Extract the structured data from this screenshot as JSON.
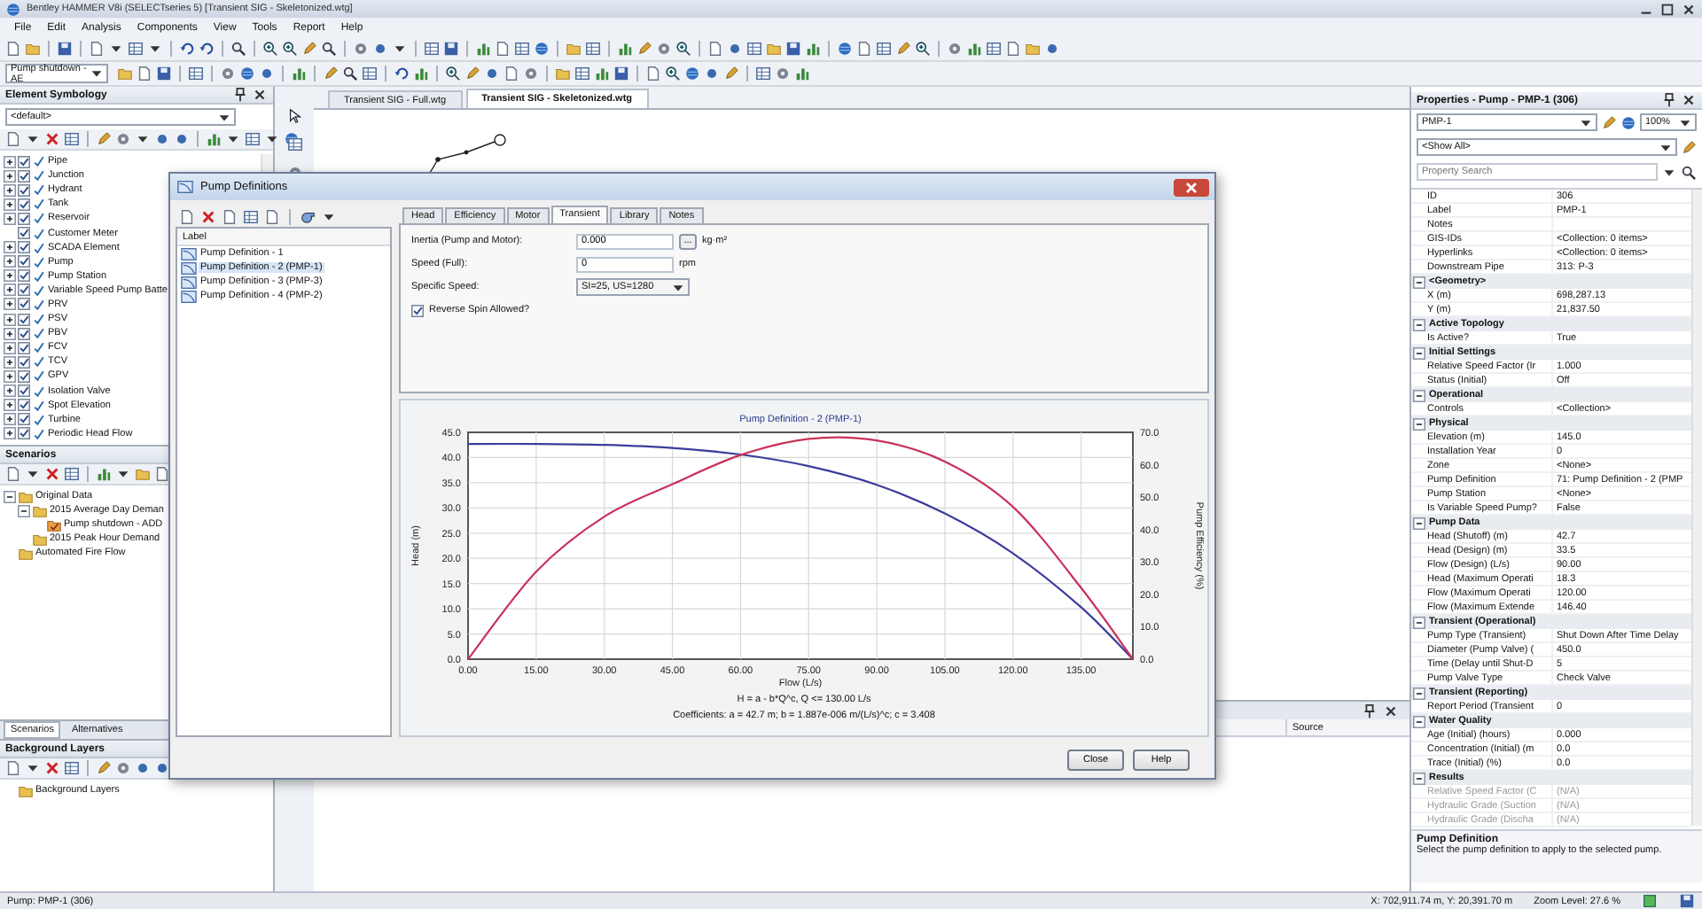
{
  "window": {
    "title": "Bentley HAMMER V8i (SELECTseries 5) [Transient SIG - Skeletonized.wtg]"
  },
  "menu": [
    "File",
    "Edit",
    "Analysis",
    "Components",
    "View",
    "Tools",
    "Report",
    "Help"
  ],
  "toolbar": {
    "scenario": "Pump shutdown - AE"
  },
  "element_symbology": {
    "title": "Element Symbology",
    "filter": "<default>",
    "items": [
      {
        "label": "Pipe",
        "checked": true,
        "expandable": true
      },
      {
        "label": "Junction",
        "checked": true,
        "expandable": true
      },
      {
        "label": "Hydrant",
        "checked": true,
        "expandable": true
      },
      {
        "label": "Tank",
        "checked": true,
        "expandable": true
      },
      {
        "label": "Reservoir",
        "checked": true,
        "expandable": true
      },
      {
        "label": "Customer Meter",
        "checked": true,
        "expandable": false
      },
      {
        "label": "SCADA Element",
        "checked": true,
        "expandable": true
      },
      {
        "label": "Pump",
        "checked": true,
        "expandable": true
      },
      {
        "label": "Pump Station",
        "checked": true,
        "expandable": true
      },
      {
        "label": "Variable Speed Pump Batte",
        "checked": true,
        "expandable": true
      },
      {
        "label": "PRV",
        "checked": true,
        "expandable": true
      },
      {
        "label": "PSV",
        "checked": true,
        "expandable": true
      },
      {
        "label": "PBV",
        "checked": true,
        "expandable": true
      },
      {
        "label": "FCV",
        "checked": true,
        "expandable": true
      },
      {
        "label": "TCV",
        "checked": true,
        "expandable": true
      },
      {
        "label": "GPV",
        "checked": true,
        "expandable": true
      },
      {
        "label": "Isolation Valve",
        "checked": true,
        "expandable": true
      },
      {
        "label": "Spot Elevation",
        "checked": true,
        "expandable": true
      },
      {
        "label": "Turbine",
        "checked": true,
        "expandable": true
      },
      {
        "label": "Periodic Head Flow",
        "checked": true,
        "expandable": true
      }
    ]
  },
  "scenarios": {
    "title": "Scenarios",
    "tree": [
      {
        "label": "Original Data",
        "kind": "folder",
        "expanded": true,
        "children": [
          {
            "label": "2015 Average Day Deman",
            "kind": "folder",
            "expanded": true,
            "children": [
              {
                "label": "Pump shutdown - ADD",
                "kind": "scenario"
              }
            ]
          },
          {
            "label": "2015 Peak Hour Demand",
            "kind": "folder"
          }
        ]
      },
      {
        "label": "Automated Fire Flow",
        "kind": "folder"
      }
    ]
  },
  "left_tabs": [
    {
      "label": "Scenarios",
      "selected": true
    },
    {
      "label": "Alternatives",
      "selected": false
    }
  ],
  "background_layers": {
    "title": "Background Layers",
    "tree": [
      {
        "label": "Background Layers",
        "kind": "folder"
      }
    ]
  },
  "document_tabs": [
    {
      "label": "Transient SIG - Full.wtg",
      "selected": false
    },
    {
      "label": "Transient SIG - Skeletonized.wtg",
      "selected": true
    }
  ],
  "bottom_panel": {
    "columns": [
      "Source"
    ]
  },
  "properties": {
    "title": "Properties - Pump - PMP-1 (306)",
    "element": "PMP-1",
    "zoom": "100%",
    "filter": "<Show All>",
    "search": {
      "placeholder": "Property Search"
    },
    "rows": [
      {
        "kind": "field",
        "label": "ID",
        "value": "306",
        "disabled": false
      },
      {
        "kind": "field",
        "label": "Label",
        "value": "PMP-1",
        "disabled": false
      },
      {
        "kind": "field",
        "label": "Notes",
        "disabled": false
      },
      {
        "kind": "field",
        "label": "GIS-IDs",
        "value": "<Collection: 0 items>",
        "disabled": false
      },
      {
        "kind": "field",
        "label": "Hyperlinks",
        "value": "<Collection: 0 items>",
        "disabled": false
      },
      {
        "kind": "field",
        "label": "Downstream Pipe",
        "value": "313: P-3",
        "disabled": false
      },
      {
        "kind": "group",
        "label": "<Geometry>",
        "expanded": true
      },
      {
        "kind": "field",
        "label": "X (m)",
        "value": "698,287.13",
        "disabled": false
      },
      {
        "kind": "field",
        "label": "Y (m)",
        "value": "21,837.50",
        "disabled": false
      },
      {
        "kind": "group",
        "label": "Active Topology",
        "expanded": true
      },
      {
        "kind": "field",
        "label": "Is Active?",
        "value": "True",
        "disabled": false
      },
      {
        "kind": "group",
        "label": "Initial Settings",
        "expanded": true
      },
      {
        "kind": "field",
        "label": "Relative Speed Factor (Ir",
        "value": "1.000",
        "disabled": false
      },
      {
        "kind": "field",
        "label": "Status (Initial)",
        "value": "Off",
        "disabled": false
      },
      {
        "kind": "group",
        "label": "Operational",
        "expanded": true
      },
      {
        "kind": "field",
        "label": "Controls",
        "value": "<Collection>",
        "disabled": false
      },
      {
        "kind": "group",
        "label": "Physical",
        "expanded": true
      },
      {
        "kind": "field",
        "label": "Elevation (m)",
        "value": "145.0",
        "disabled": false
      },
      {
        "kind": "field",
        "label": "Installation Year",
        "value": "0",
        "disabled": false
      },
      {
        "kind": "field",
        "label": "Zone",
        "value": "<None>",
        "disabled": false
      },
      {
        "kind": "field",
        "label": "Pump Definition",
        "value": "71: Pump Definition - 2 (PMP",
        "disabled": false
      },
      {
        "kind": "field",
        "label": "Pump Station",
        "value": "<None>",
        "disabled": false
      },
      {
        "kind": "field",
        "label": "Is Variable Speed Pump?",
        "value": "False",
        "disabled": false
      },
      {
        "kind": "group",
        "label": "Pump Data",
        "expanded": true
      },
      {
        "kind": "field",
        "label": "Head (Shutoff) (m)",
        "value": "42.7",
        "disabled": false
      },
      {
        "kind": "field",
        "label": "Head (Design) (m)",
        "value": "33.5",
        "disabled": false
      },
      {
        "kind": "field",
        "label": "Flow (Design) (L/s)",
        "value": "90.00",
        "disabled": false
      },
      {
        "kind": "field",
        "label": "Head (Maximum Operati",
        "value": "18.3",
        "disabled": false
      },
      {
        "kind": "field",
        "label": "Flow (Maximum Operati",
        "value": "120.00",
        "disabled": false
      },
      {
        "kind": "field",
        "label": "Flow (Maximum Extende",
        "value": "146.40",
        "disabled": false
      },
      {
        "kind": "group",
        "label": "Transient (Operational)",
        "expanded": true
      },
      {
        "kind": "field",
        "label": "Pump Type (Transient)",
        "value": "Shut Down After Time Delay",
        "disabled": false
      },
      {
        "kind": "field",
        "label": "Diameter (Pump Valve) (",
        "value": "450.0",
        "disabled": false
      },
      {
        "kind": "field",
        "label": "Time (Delay until Shut-D",
        "value": "5",
        "disabled": false
      },
      {
        "kind": "field",
        "label": "Pump Valve Type",
        "value": "Check Valve",
        "disabled": false
      },
      {
        "kind": "group",
        "label": "Transient (Reporting)",
        "expanded": true
      },
      {
        "kind": "field",
        "label": "Report Period (Transient",
        "value": "0",
        "disabled": false
      },
      {
        "kind": "group",
        "label": "Water Quality",
        "expanded": true
      },
      {
        "kind": "field",
        "label": "Age (Initial) (hours)",
        "value": "0.000",
        "disabled": false
      },
      {
        "kind": "field",
        "label": "Concentration (Initial) (m",
        "value": "0.0",
        "disabled": false
      },
      {
        "kind": "field",
        "label": "Trace (Initial) (%)",
        "value": "0.0",
        "disabled": false
      },
      {
        "kind": "group",
        "label": "Results",
        "expanded": true
      },
      {
        "kind": "field",
        "label": "Relative Speed Factor (C",
        "value": "(N/A)",
        "disabled": true
      },
      {
        "kind": "field",
        "label": "Hydraulic Grade (Suction",
        "value": "(N/A)",
        "disabled": true
      },
      {
        "kind": "field",
        "label": "Hydraulic Grade (Discha",
        "value": "(N/A)",
        "disabled": true
      }
    ],
    "description": {
      "title": "Pump Definition",
      "text": "Select the pump definition to apply to the selected pump."
    }
  },
  "dialog": {
    "title": "Pump Definitions",
    "list_header": "Label",
    "definitions": [
      {
        "label": "Pump Definition - 1",
        "selected": false
      },
      {
        "label": "Pump Definition - 2 (PMP-1)",
        "selected": true
      },
      {
        "label": "Pump Definition - 3 (PMP-3)",
        "selected": false
      },
      {
        "label": "Pump Definition - 4 (PMP-2)",
        "selected": false
      }
    ],
    "tabs": [
      {
        "label": "Head",
        "selected": false
      },
      {
        "label": "Efficiency",
        "selected": false
      },
      {
        "label": "Motor",
        "selected": false
      },
      {
        "label": "Transient",
        "selected": true
      },
      {
        "label": "Library",
        "selected": false
      },
      {
        "label": "Notes",
        "selected": false
      }
    ],
    "fields": [
      {
        "kind": "number-button",
        "label": "Inertia (Pump and Motor):",
        "value": "0.000",
        "button": "...",
        "unit": "kg·m²"
      },
      {
        "kind": "number",
        "label": "Speed (Full):",
        "value": "0",
        "unit": "rpm"
      },
      {
        "kind": "select",
        "label": "Specific Speed:",
        "value": "SI=25, US=1280"
      },
      {
        "kind": "checkbox",
        "label": "Reverse Spin Allowed?",
        "checked": true
      }
    ],
    "chart_data": {
      "type": "line",
      "title": "Pump Definition - 2 (PMP-1)",
      "xlabel": "Flow (L/s)",
      "ylabel": "Head (m)",
      "y2label": "Pump Efficiency (%)",
      "x": [
        0,
        15,
        30,
        45,
        60,
        75,
        90,
        105,
        120,
        135,
        146.4
      ],
      "series": [
        {
          "color": "#3c3c9c",
          "values": [
            42.7,
            42.7,
            42.5,
            41.9,
            40.6,
            38.3,
            34.6,
            28.9,
            21.0,
            10.3,
            0
          ]
        },
        {
          "color": "#c8325a",
          "axis": "y2",
          "values": [
            0,
            27,
            44,
            54,
            63,
            68,
            67.5,
            61,
            47,
            22,
            0
          ]
        }
      ],
      "grid": true,
      "xlim": [
        0,
        146.4
      ],
      "ylim": [
        0,
        45
      ],
      "y2lim": [
        0,
        70
      ],
      "xticks": [
        {
          "value": 0,
          "label": "0.00"
        },
        {
          "value": 15,
          "label": "15.00"
        },
        {
          "value": 30,
          "label": "30.00"
        },
        {
          "value": 45,
          "label": "45.00"
        },
        {
          "value": 60,
          "label": "60.00"
        },
        {
          "value": 75,
          "label": "75.00"
        },
        {
          "value": 90,
          "label": "90.00"
        },
        {
          "value": 105,
          "label": "105.00"
        },
        {
          "value": 120,
          "label": "120.00"
        },
        {
          "value": 135,
          "label": "135.00"
        }
      ],
      "yticks": [
        {
          "value": 0,
          "label": "0.0"
        },
        {
          "value": 5,
          "label": "5.0"
        },
        {
          "value": 10,
          "label": "10.0"
        },
        {
          "value": 15,
          "label": "15.0"
        },
        {
          "value": 20,
          "label": "20.0"
        },
        {
          "value": 25,
          "label": "25.0"
        },
        {
          "value": 30,
          "label": "30.0"
        },
        {
          "value": 35,
          "label": "35.0"
        },
        {
          "value": 40,
          "label": "40.0"
        },
        {
          "value": 45,
          "label": "45.0"
        }
      ],
      "y2ticks": [
        {
          "value": 0,
          "label": "0.0"
        },
        {
          "value": 10,
          "label": "10.0"
        },
        {
          "value": 20,
          "label": "20.0"
        },
        {
          "value": 30,
          "label": "30.0"
        },
        {
          "value": 40,
          "label": "40.0"
        },
        {
          "value": 50,
          "label": "50.0"
        },
        {
          "value": 60,
          "label": "60.0"
        },
        {
          "value": 70,
          "label": "70.0"
        }
      ]
    },
    "equation": "H = a - b*Q^c, Q <= 130.00 L/s",
    "coefficients": "Coefficients: a = 42.7 m; b = 1.887e-006 m/(L/s)^c; c = 3.408",
    "buttons": [
      "Close",
      "Help"
    ]
  },
  "status_bar": {
    "element": "Pump: PMP-1 (306)",
    "coordinates": "X: 702,911.74 m, Y: 20,391.70 m",
    "zoom": "Zoom Level: 27.6 %"
  }
}
